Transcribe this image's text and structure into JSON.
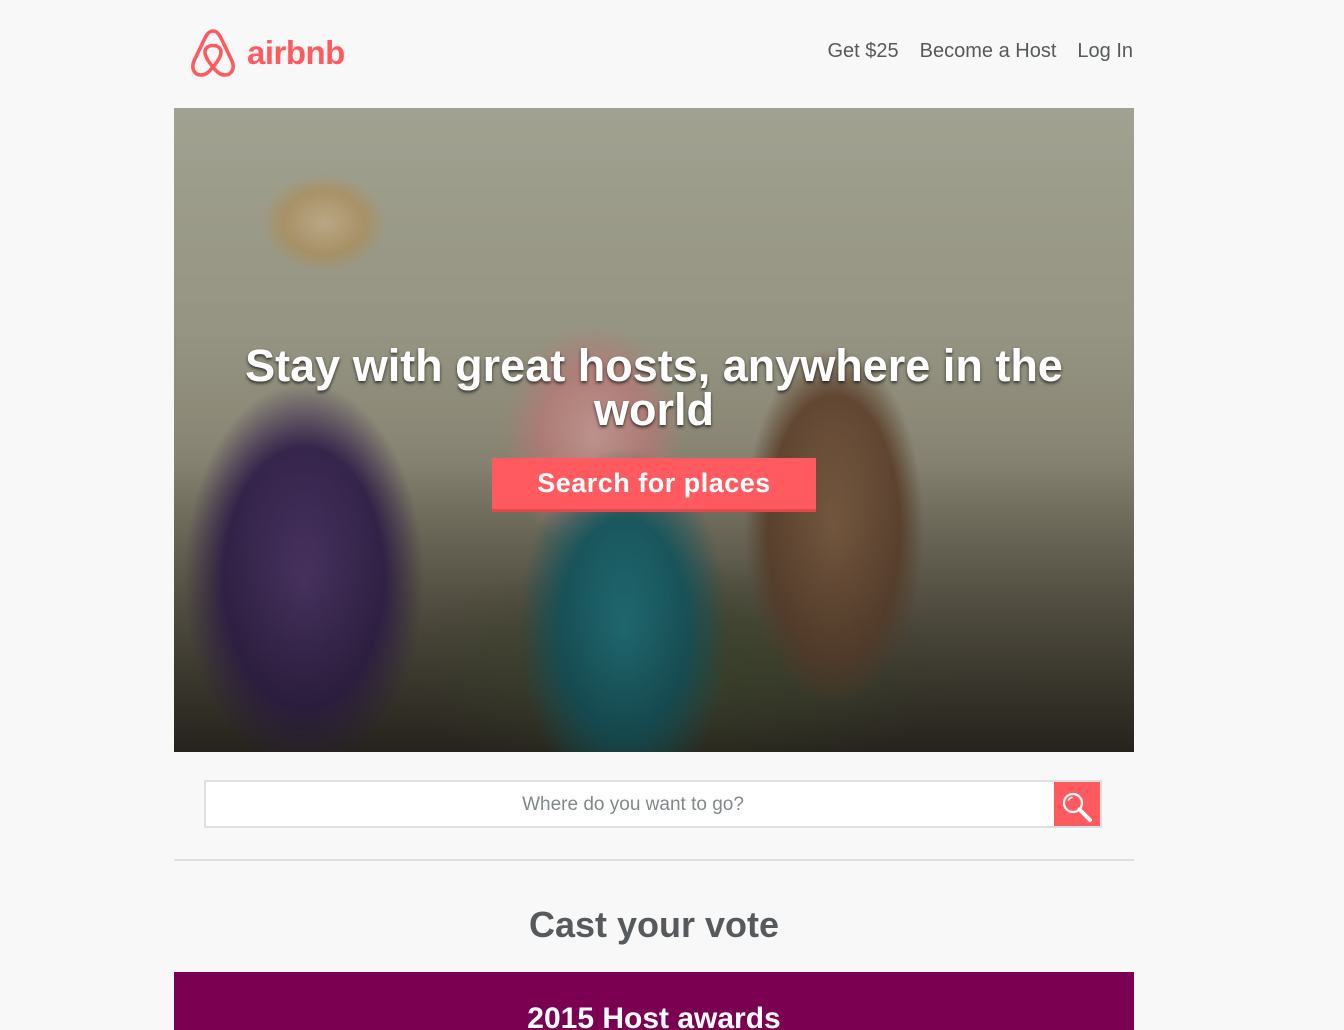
{
  "brand": {
    "name": "airbnb",
    "color": "#ff5a5f",
    "logo_icon": "airbnb-belo-icon"
  },
  "nav": {
    "items": [
      {
        "label": "Get $25"
      },
      {
        "label": "Become a Host"
      },
      {
        "label": "Log In"
      }
    ]
  },
  "hero": {
    "title": "Stay with great hosts, anywhere in the world",
    "cta_label": "Search for places"
  },
  "search": {
    "placeholder": "Where do you want to go?",
    "value": "",
    "button_icon": "search-icon"
  },
  "vote": {
    "title": "Cast your vote"
  },
  "awards": {
    "title": "2015 Host awards",
    "color": "#7b0051"
  }
}
